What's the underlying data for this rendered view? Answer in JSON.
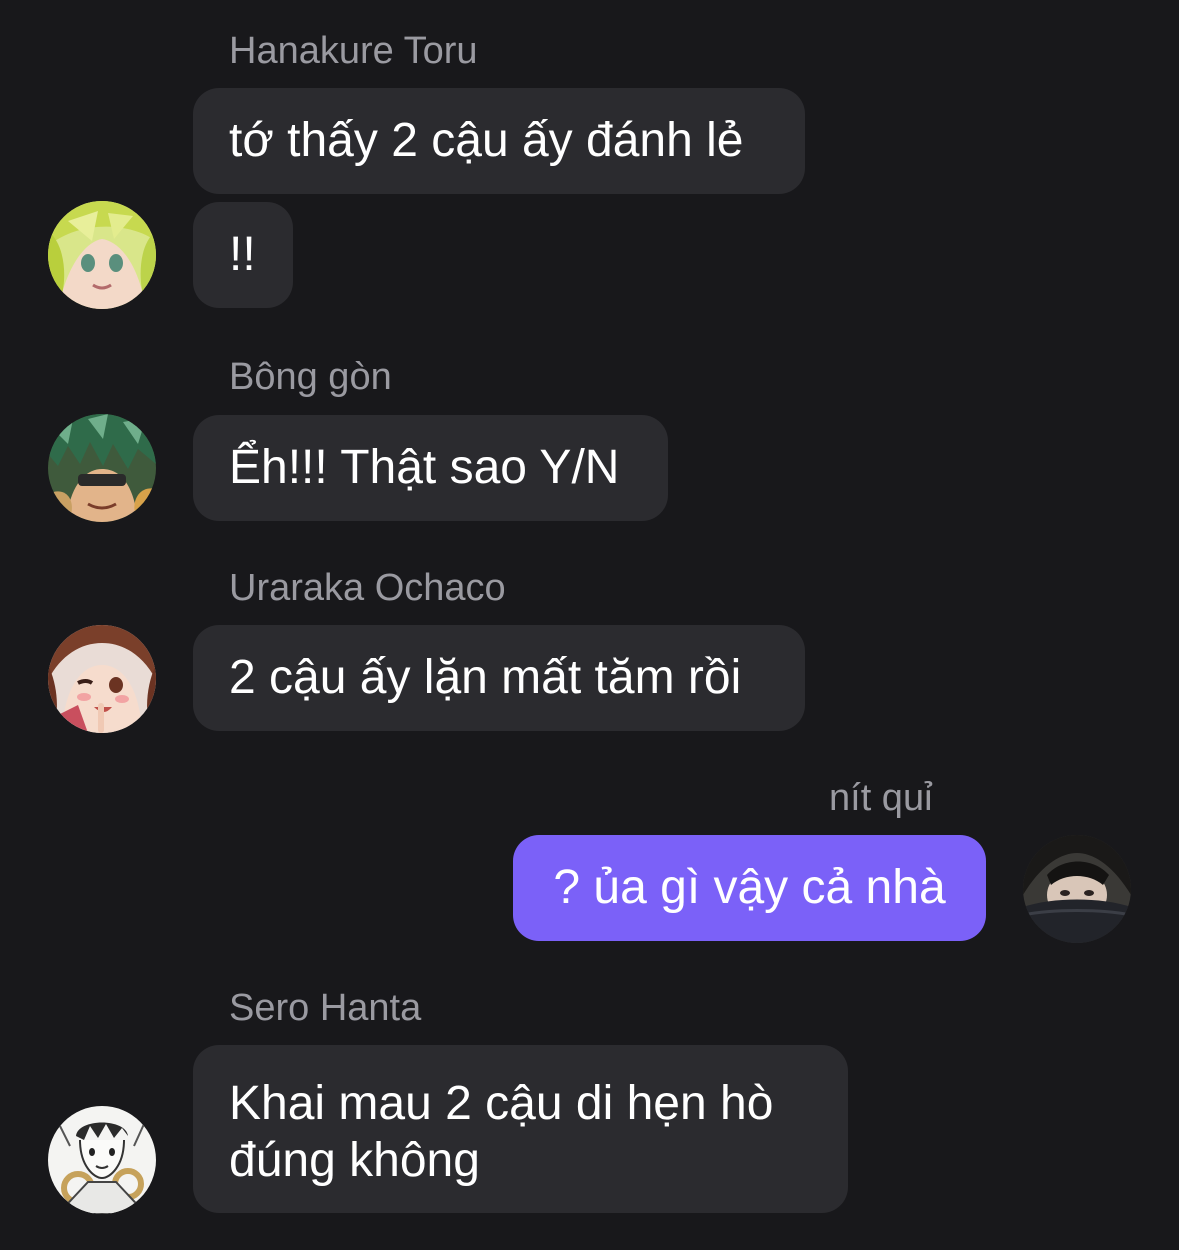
{
  "chat": {
    "messages": [
      {
        "sender": "Hanakure Toru",
        "texts": [
          "tớ thấy 2 cậu ấy đánh lẻ",
          "!!"
        ],
        "avatar_icon": "avatar-blonde-anime-girl-icon",
        "outgoing": false
      },
      {
        "sender": "Bông gòn",
        "texts": [
          "Ểh!!! Thật sao Y/N"
        ],
        "avatar_icon": "avatar-green-haired-anime-boy-icon",
        "outgoing": false
      },
      {
        "sender": "Uraraka Ochaco",
        "texts": [
          "2 cậu ấy lặn mất tăm rồi"
        ],
        "avatar_icon": "avatar-brown-haired-anime-girl-icon",
        "outgoing": false
      },
      {
        "sender": "nít quỉ",
        "texts": [
          "? ủa gì vậy cả nhà"
        ],
        "avatar_icon": "avatar-dark-photo-girl-icon",
        "outgoing": true
      },
      {
        "sender": "Sero Hanta",
        "texts": [
          "Khai mau 2 cậu di hẹn hò đúng không"
        ],
        "avatar_icon": "avatar-manga-sketch-boy-icon",
        "outgoing": false
      }
    ]
  },
  "colors": {
    "background": "#18181b",
    "incoming_bubble": "#2b2b2f",
    "outgoing_bubble": "#7b61f8",
    "sender_name": "#9a9aa1",
    "message_text": "#ffffff"
  }
}
